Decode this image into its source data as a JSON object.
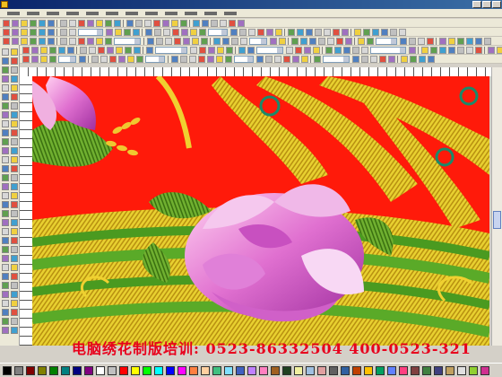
{
  "window": {
    "title": "",
    "icon": "app-icon"
  },
  "window_buttons": [
    {
      "name": "minimize-button",
      "icon": "minimize-icon"
    },
    {
      "name": "maximize-button",
      "icon": "maximize-icon"
    },
    {
      "name": "close-button",
      "icon": "close-icon"
    }
  ],
  "menu": [
    {
      "label": ""
    },
    {
      "label": ""
    },
    {
      "label": ""
    },
    {
      "label": ""
    },
    {
      "label": ""
    },
    {
      "label": ""
    },
    {
      "label": ""
    },
    {
      "label": ""
    },
    {
      "label": ""
    },
    {
      "label": ""
    },
    {
      "label": ""
    },
    {
      "label": ""
    }
  ],
  "toolbar_colors": [
    "#d8d8d8",
    "#f0d040",
    "#5080c0",
    "#e05040",
    "#60a050",
    "#c0c0c0",
    "#a070c0",
    "#40a0d0"
  ],
  "palette_colors": [
    "#000000",
    "#808080",
    "#800000",
    "#808000",
    "#008000",
    "#008080",
    "#000080",
    "#800080",
    "#ffffff",
    "#c0c0c0",
    "#ff0000",
    "#ffff00",
    "#00ff00",
    "#00ffff",
    "#0000ff",
    "#ff00ff",
    "#ff8040",
    "#ffd0a0",
    "#40c080",
    "#80e0ff",
    "#4060c0",
    "#c080ff",
    "#ff80c0",
    "#a06020",
    "#204020",
    "#f0f0a0",
    "#a0c0e0",
    "#e0a0a0",
    "#606060",
    "#3060a0",
    "#c04000",
    "#ffc000",
    "#00a060",
    "#6080ff",
    "#ff4080",
    "#804040",
    "#408040",
    "#404080",
    "#c0a060",
    "#e0e0e0",
    "#90d030",
    "#d03090"
  ],
  "design": {
    "background_color": "#ff1a0a",
    "elements": [
      "peony-flower",
      "leaves",
      "golden-feathers",
      "green-gold-waves",
      "wheat-ears"
    ]
  },
  "caption": {
    "text": "电脑绣花制版培训: 0523-86332504  400-0523-321"
  }
}
